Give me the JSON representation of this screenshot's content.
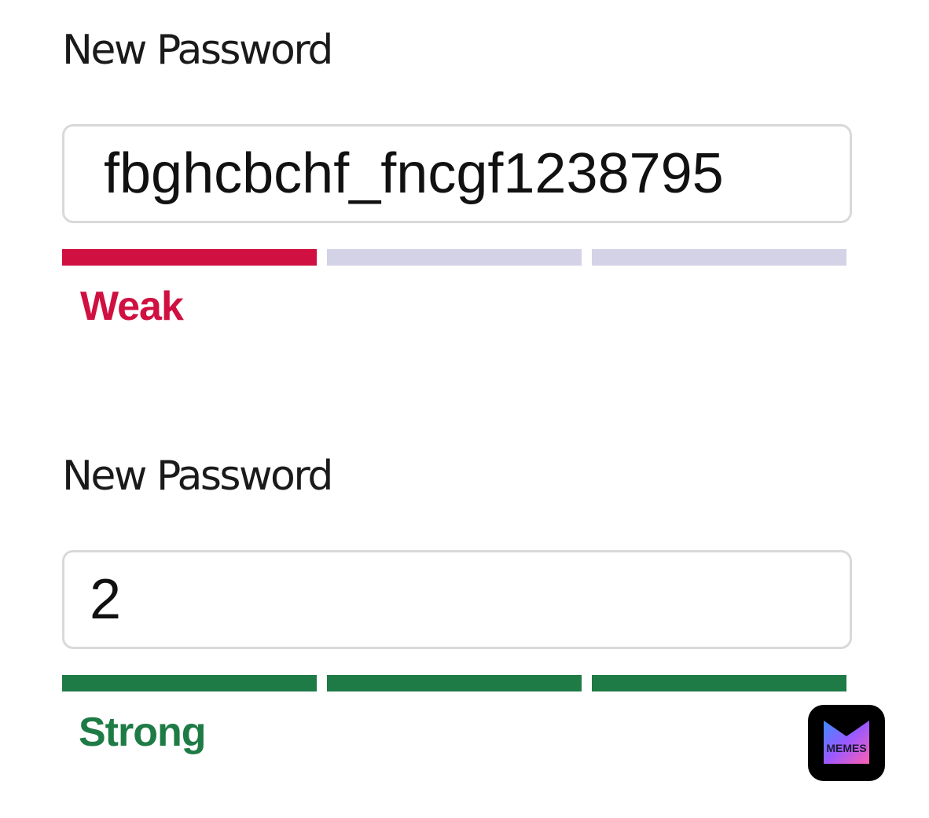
{
  "forms": [
    {
      "label": "New Password",
      "password_value": "fbghcbchf_fncgf1238795",
      "strength": {
        "text": "Weak",
        "filled_segments": 1,
        "total_segments": 3,
        "active_color": "#cf1040",
        "inactive_color": "#d3d2e6"
      }
    },
    {
      "label": "New Password",
      "password_value": "2",
      "strength": {
        "text": "Strong",
        "filled_segments": 3,
        "total_segments": 3,
        "active_color": "#1e7b45",
        "inactive_color": "#d3d2e6"
      }
    }
  ],
  "watermark": {
    "text": "MEMES",
    "icon": "memes-logo-icon"
  }
}
